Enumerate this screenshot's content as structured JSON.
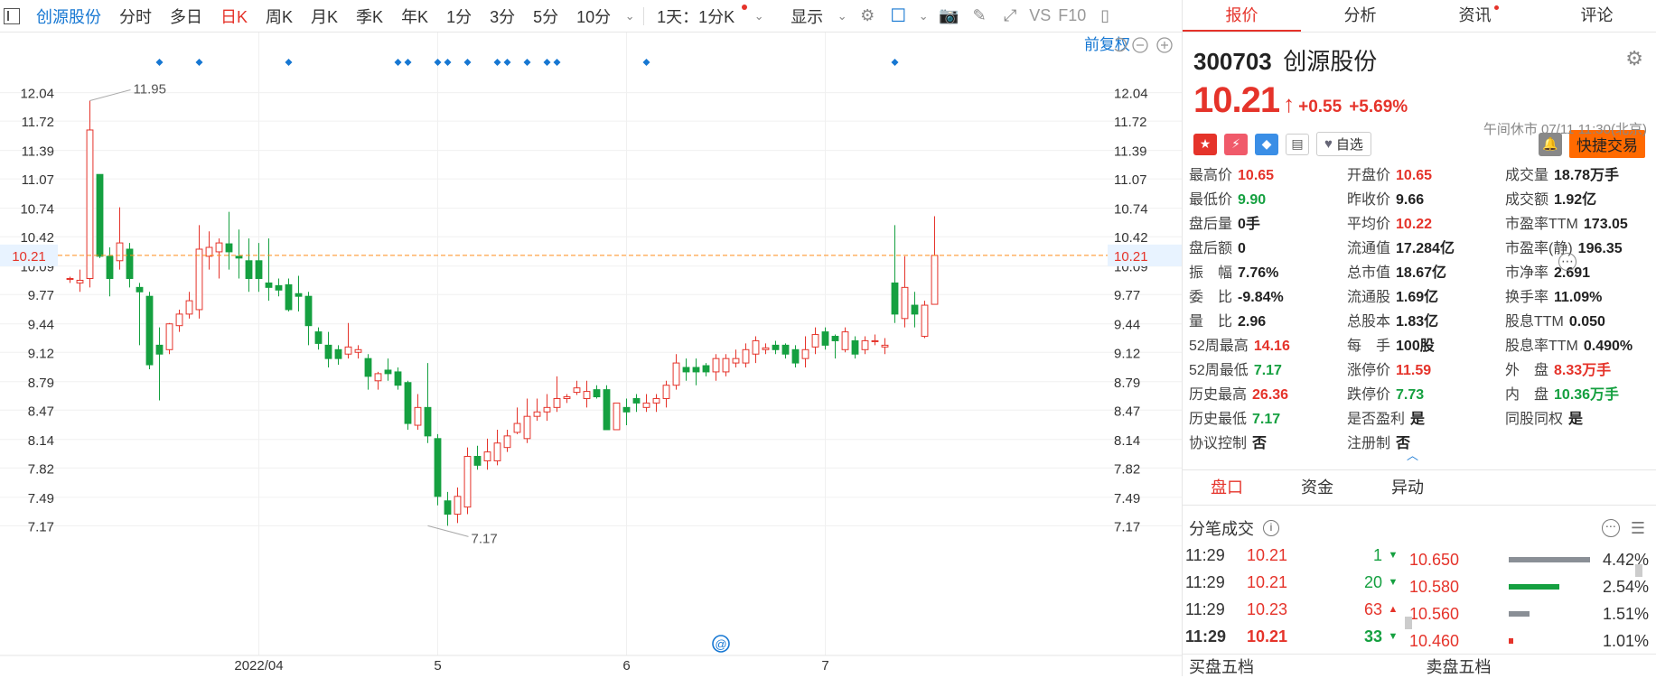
{
  "toolbar": {
    "stock_name": "创源股份",
    "items": [
      "分时",
      "多日",
      "日K",
      "周K",
      "月K",
      "季K",
      "年K",
      "1分",
      "3分",
      "5分",
      "10分"
    ],
    "active_index": 2,
    "period_select": "1天：1分K",
    "display_label": "显示",
    "vs_label": "VS",
    "f10_label": "F10"
  },
  "chart_controls": {
    "adjust_label": "前复权"
  },
  "chart_data": {
    "type": "candlestick",
    "y_ticks": [
      "12.04",
      "11.72",
      "11.39",
      "11.07",
      "10.74",
      "10.42",
      "10.09",
      "9.77",
      "9.44",
      "9.12",
      "8.79",
      "8.47",
      "8.14",
      "7.82",
      "7.49",
      "7.17"
    ],
    "ylim": [
      6.93,
      12.31
    ],
    "x_ticks": [
      "2022/04",
      "5",
      "6",
      "7"
    ],
    "x_tick_index": [
      19,
      37,
      56,
      76
    ],
    "current_price_label": "10.21",
    "high_annotation": "11.95",
    "high_index": 2,
    "low_annotation": "7.17",
    "low_index": 36,
    "marker_indices": [
      9,
      13,
      22,
      33,
      34,
      37,
      38,
      40,
      43,
      44,
      46,
      48,
      49,
      58,
      83
    ],
    "candles": [
      [
        9.95,
        9.97,
        9.9,
        9.95
      ],
      [
        9.9,
        10.05,
        9.8,
        9.93
      ],
      [
        9.95,
        11.95,
        9.85,
        11.62
      ],
      [
        11.12,
        11.12,
        10.18,
        10.2
      ],
      [
        10.2,
        10.3,
        9.75,
        9.95
      ],
      [
        10.15,
        10.75,
        10.05,
        10.35
      ],
      [
        10.28,
        10.35,
        9.85,
        9.95
      ],
      [
        9.85,
        9.9,
        9.2,
        9.8
      ],
      [
        9.75,
        9.8,
        8.93,
        8.98
      ],
      [
        9.2,
        9.4,
        8.58,
        9.1
      ],
      [
        9.15,
        9.45,
        9.1,
        9.44
      ],
      [
        9.42,
        9.6,
        9.35,
        9.55
      ],
      [
        9.55,
        9.8,
        9.5,
        9.7
      ],
      [
        9.6,
        10.55,
        9.5,
        10.28
      ],
      [
        10.2,
        10.48,
        10.05,
        10.3
      ],
      [
        10.25,
        10.4,
        9.95,
        10.35
      ],
      [
        10.34,
        10.7,
        10.05,
        10.25
      ],
      [
        10.2,
        10.5,
        9.95,
        10.18
      ],
      [
        10.15,
        10.4,
        9.8,
        9.95
      ],
      [
        10.15,
        10.35,
        9.8,
        9.95
      ],
      [
        9.9,
        10.4,
        9.7,
        9.85
      ],
      [
        9.87,
        9.95,
        9.75,
        9.82
      ],
      [
        9.88,
        9.95,
        9.58,
        9.6
      ],
      [
        9.78,
        9.98,
        9.58,
        9.75
      ],
      [
        9.75,
        9.8,
        9.2,
        9.42
      ],
      [
        9.35,
        9.4,
        9.15,
        9.22
      ],
      [
        9.2,
        9.35,
        8.95,
        9.05
      ],
      [
        9.15,
        9.2,
        8.98,
        9.05
      ],
      [
        9.1,
        9.45,
        9.05,
        9.18
      ],
      [
        9.12,
        9.2,
        9.05,
        9.15
      ],
      [
        9.05,
        9.1,
        8.7,
        8.85
      ],
      [
        8.8,
        8.9,
        8.7,
        8.88
      ],
      [
        8.92,
        9.05,
        8.8,
        8.88
      ],
      [
        8.9,
        8.95,
        8.7,
        8.75
      ],
      [
        8.78,
        8.8,
        8.25,
        8.32
      ],
      [
        8.3,
        8.65,
        8.25,
        8.5
      ],
      [
        8.5,
        9.0,
        8.1,
        8.18
      ],
      [
        8.15,
        8.2,
        7.4,
        7.5
      ],
      [
        7.45,
        7.55,
        7.17,
        7.3
      ],
      [
        7.3,
        7.6,
        7.2,
        7.5
      ],
      [
        7.38,
        8.05,
        7.3,
        7.95
      ],
      [
        7.95,
        8.07,
        7.8,
        7.85
      ],
      [
        7.9,
        8.15,
        7.8,
        8.0
      ],
      [
        7.9,
        8.25,
        7.85,
        8.1
      ],
      [
        8.05,
        8.25,
        8.0,
        8.18
      ],
      [
        8.22,
        8.5,
        8.2,
        8.32
      ],
      [
        8.15,
        8.6,
        8.1,
        8.4
      ],
      [
        8.4,
        8.6,
        8.35,
        8.45
      ],
      [
        8.45,
        8.65,
        8.35,
        8.5
      ],
      [
        8.5,
        8.85,
        8.45,
        8.6
      ],
      [
        8.6,
        8.65,
        8.55,
        8.62
      ],
      [
        8.67,
        8.8,
        8.64,
        8.72
      ],
      [
        8.6,
        8.8,
        8.5,
        8.68
      ],
      [
        8.7,
        8.75,
        8.6,
        8.62
      ],
      [
        8.7,
        8.75,
        8.25,
        8.25
      ],
      [
        8.25,
        8.55,
        8.25,
        8.55
      ],
      [
        8.5,
        8.6,
        8.3,
        8.45
      ],
      [
        8.6,
        8.65,
        8.45,
        8.55
      ],
      [
        8.5,
        8.65,
        8.45,
        8.55
      ],
      [
        8.55,
        8.65,
        8.45,
        8.6
      ],
      [
        8.6,
        8.8,
        8.5,
        8.75
      ],
      [
        8.75,
        9.1,
        8.7,
        9.0
      ],
      [
        8.95,
        9.05,
        8.8,
        8.9
      ],
      [
        8.95,
        9.05,
        8.75,
        8.9
      ],
      [
        8.97,
        9.0,
        8.85,
        8.9
      ],
      [
        8.9,
        9.1,
        8.8,
        9.05
      ],
      [
        8.9,
        9.1,
        8.85,
        9.05
      ],
      [
        9.0,
        9.15,
        8.95,
        9.05
      ],
      [
        9.0,
        9.22,
        8.95,
        9.15
      ],
      [
        9.1,
        9.3,
        9.0,
        9.25
      ],
      [
        9.15,
        9.22,
        9.1,
        9.17
      ],
      [
        9.2,
        9.25,
        9.1,
        9.15
      ],
      [
        9.2,
        9.22,
        9.05,
        9.1
      ],
      [
        9.15,
        9.2,
        8.95,
        9.0
      ],
      [
        9.05,
        9.3,
        8.95,
        9.15
      ],
      [
        9.18,
        9.4,
        9.1,
        9.32
      ],
      [
        9.35,
        9.4,
        9.15,
        9.2
      ],
      [
        9.3,
        9.32,
        9.05,
        9.25
      ],
      [
        9.15,
        9.4,
        9.12,
        9.35
      ],
      [
        9.25,
        9.3,
        9.05,
        9.1
      ],
      [
        9.15,
        9.3,
        9.1,
        9.25
      ],
      [
        9.25,
        9.32,
        9.2,
        9.25
      ],
      [
        9.18,
        9.28,
        9.1,
        9.2
      ],
      [
        9.9,
        10.55,
        9.45,
        9.55
      ],
      [
        9.5,
        10.2,
        9.4,
        9.85
      ],
      [
        9.65,
        9.8,
        9.4,
        9.55
      ],
      [
        9.3,
        9.7,
        9.28,
        9.65
      ],
      [
        9.66,
        10.65,
        9.9,
        10.21
      ]
    ]
  },
  "stock": {
    "code": "300703",
    "name": "创源股份",
    "price": "10.21",
    "change": "+0.55",
    "change_pct": "+5.69%",
    "market_status": "午间休市 07/11 11:30(北京)",
    "watch_label": "自选",
    "trade_label": "快捷交易"
  },
  "tabs": [
    {
      "label": "报价",
      "active": true
    },
    {
      "label": "分析",
      "active": false
    },
    {
      "label": "资讯",
      "active": false,
      "dot": true
    },
    {
      "label": "评论",
      "active": false
    }
  ],
  "stats": [
    [
      [
        "最高价",
        "10.65",
        "r"
      ],
      [
        "开盘价",
        "10.65",
        "r"
      ],
      [
        "成交量",
        "18.78万手",
        ""
      ]
    ],
    [
      [
        "最低价",
        "9.90",
        "g"
      ],
      [
        "昨收价",
        "9.66",
        ""
      ],
      [
        "成交额",
        "1.92亿",
        ""
      ]
    ],
    [
      [
        "盘后量",
        "0手",
        ""
      ],
      [
        "平均价",
        "10.22",
        "r"
      ],
      [
        "市盈率TTM",
        "173.05",
        ""
      ]
    ],
    [
      [
        "盘后额",
        "0",
        ""
      ],
      [
        "流通值",
        "17.284亿",
        ""
      ],
      [
        "市盈率(静)",
        "196.35",
        ""
      ]
    ],
    [
      [
        "振　幅",
        "7.76%",
        ""
      ],
      [
        "总市值",
        "18.67亿",
        ""
      ],
      [
        "市净率",
        "2.691",
        ""
      ]
    ],
    [
      [
        "委　比",
        "-9.84%",
        ""
      ],
      [
        "流通股",
        "1.69亿",
        ""
      ],
      [
        "换手率",
        "11.09%",
        ""
      ]
    ],
    [
      [
        "量　比",
        "2.96",
        ""
      ],
      [
        "总股本",
        "1.83亿",
        ""
      ],
      [
        "股息TTM",
        "0.050",
        ""
      ]
    ],
    [
      [
        "52周最高",
        "14.16",
        "r"
      ],
      [
        "每　手",
        "100股",
        ""
      ],
      [
        "股息率TTM",
        "0.490%",
        ""
      ]
    ],
    [
      [
        "52周最低",
        "7.17",
        "g"
      ],
      [
        "涨停价",
        "11.59",
        "r"
      ],
      [
        "外　盘",
        "8.33万手",
        "r"
      ]
    ],
    [
      [
        "历史最高",
        "26.36",
        "r"
      ],
      [
        "跌停价",
        "7.73",
        "g"
      ],
      [
        "内　盘",
        "10.36万手",
        "g"
      ]
    ],
    [
      [
        "历史最低",
        "7.17",
        "g"
      ],
      [
        "是否盈利",
        "是",
        ""
      ],
      [
        "同股同权",
        "是",
        ""
      ]
    ],
    [
      [
        "协议控制",
        "否",
        ""
      ],
      [
        "注册制",
        "否",
        ""
      ],
      [
        "",
        "",
        ""
      ]
    ]
  ],
  "subtabs": [
    "盘口",
    "资金",
    "异动"
  ],
  "trades_title": "分笔成交",
  "trades": [
    {
      "time": "11:29",
      "price": "10.21",
      "vol": "1",
      "dir": "down"
    },
    {
      "time": "11:29",
      "price": "10.21",
      "vol": "20",
      "dir": "down"
    },
    {
      "time": "11:29",
      "price": "10.23",
      "vol": "63",
      "dir": "up"
    },
    {
      "time": "11:29",
      "price": "10.21",
      "vol": "33",
      "dir": "down"
    }
  ],
  "depth": [
    {
      "price": "10.650",
      "pct": "4.42%",
      "color": "#8a8f96",
      "fill": 1.0
    },
    {
      "price": "10.580",
      "pct": "2.54%",
      "color": "#15a040",
      "fill": 0.62
    },
    {
      "price": "10.560",
      "pct": "1.51%",
      "color": "#8a8f96",
      "fill": 0.25
    },
    {
      "price": "10.460",
      "pct": "1.01%",
      "color": "#e5332a",
      "fill": 0.06
    }
  ],
  "bottom": [
    "买盘五档",
    "卖盘五档"
  ],
  "colors": {
    "up": "#e5332a",
    "down": "#15a040",
    "accent": "#1677d2",
    "guide": "#ff8c1a"
  }
}
